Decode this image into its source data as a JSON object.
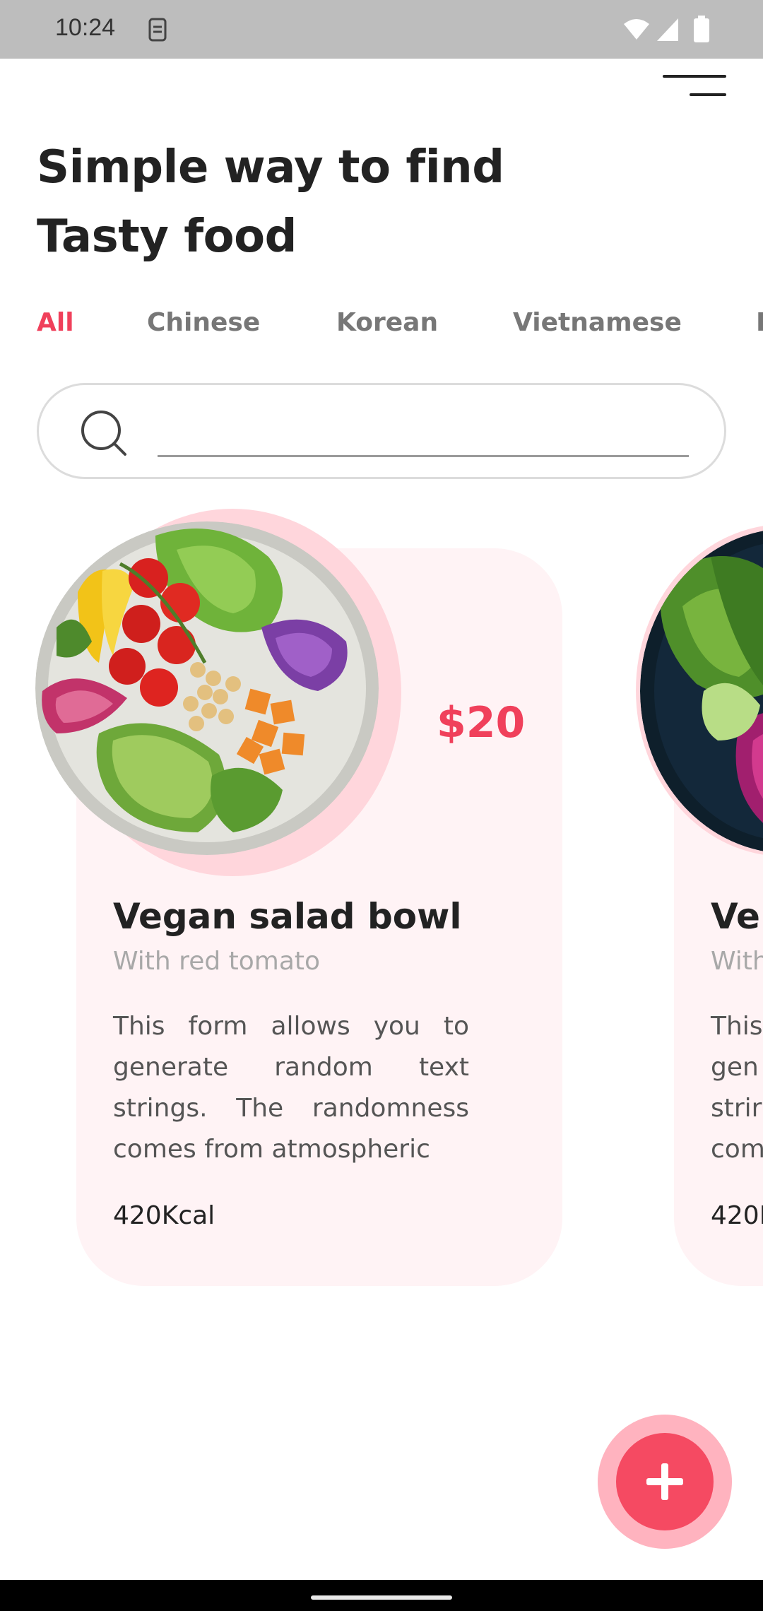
{
  "status_bar": {
    "time": "10:24",
    "icons": [
      "sim-icon",
      "wifi-icon",
      "signal-icon",
      "battery-icon"
    ]
  },
  "header": {
    "menu_icon": "hamburger-menu-icon",
    "title_line1": "Simple way to find",
    "title_line2": "Tasty food"
  },
  "tabs": [
    {
      "label": "All",
      "active": true
    },
    {
      "label": "Chinese",
      "active": false
    },
    {
      "label": "Korean",
      "active": false
    },
    {
      "label": "Vietnamese",
      "active": false
    },
    {
      "label": "I",
      "active": false
    }
  ],
  "search": {
    "icon": "search-icon",
    "placeholder": ""
  },
  "cards": [
    {
      "price": "$20",
      "title": "Vegan salad bowl",
      "subtitle": "With red tomato",
      "description": "This form allows you to generate random text strings. The randomness comes from atmospheric",
      "kcal": "420Kcal"
    },
    {
      "title": "Ve",
      "subtitle": "With",
      "description": "This gen strir com",
      "kcal": "420I"
    }
  ],
  "fab": {
    "icon": "plus-icon"
  },
  "colors": {
    "accent": "#f0405b",
    "card_bg": "#fff3f5",
    "halo": "#ffd6dc",
    "status_bar": "#bdbdbd"
  }
}
